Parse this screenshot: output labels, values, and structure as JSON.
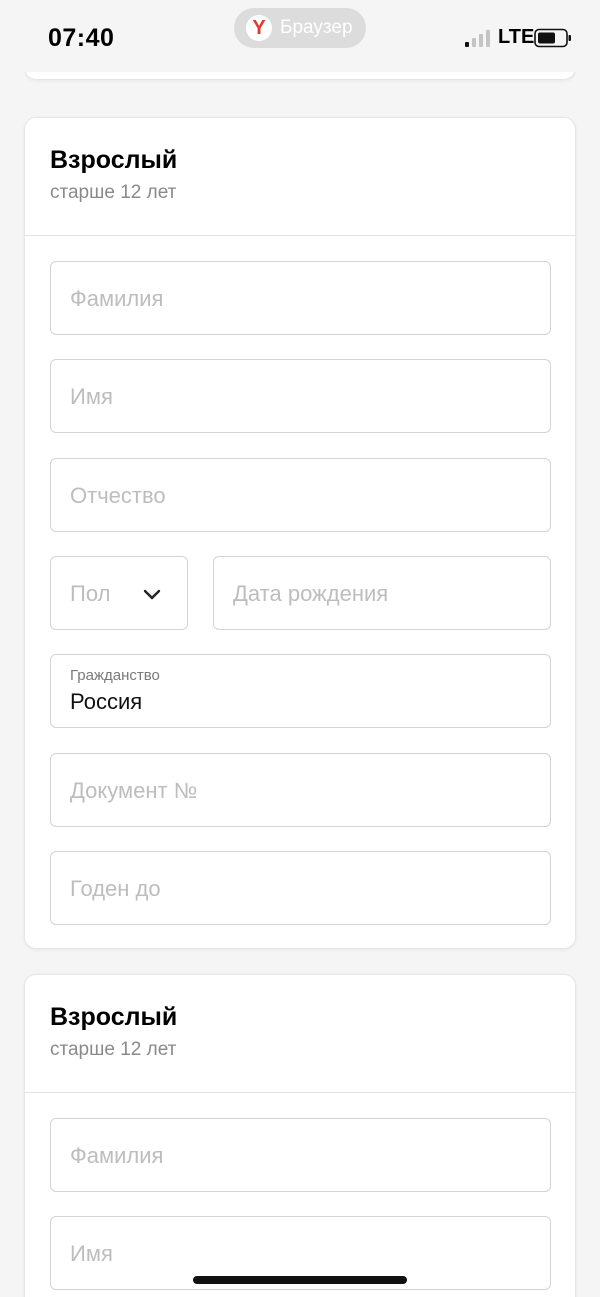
{
  "status_bar": {
    "time": "07:40",
    "browser_label": "Браузер",
    "browser_logo_letter": "Y",
    "network": "LTE"
  },
  "passengers": [
    {
      "title": "Взрослый",
      "subtitle": "старше 12 лет",
      "fields": {
        "last_name_placeholder": "Фамилия",
        "first_name_placeholder": "Имя",
        "middle_name_placeholder": "Отчество",
        "gender_placeholder": "Пол",
        "birth_date_placeholder": "Дата рождения",
        "citizenship_label": "Гражданство",
        "citizenship_value": "Россия",
        "document_placeholder": "Документ №",
        "valid_until_placeholder": "Годен до"
      }
    },
    {
      "title": "Взрослый",
      "subtitle": "старше 12 лет",
      "fields": {
        "last_name_placeholder": "Фамилия",
        "first_name_placeholder": "Имя"
      }
    }
  ],
  "colors": {
    "background": "#f5f5f5",
    "card": "#ffffff",
    "border": "#d4d4d4",
    "placeholder": "#bdbdbd",
    "yandex_red": "#e03a2e"
  }
}
